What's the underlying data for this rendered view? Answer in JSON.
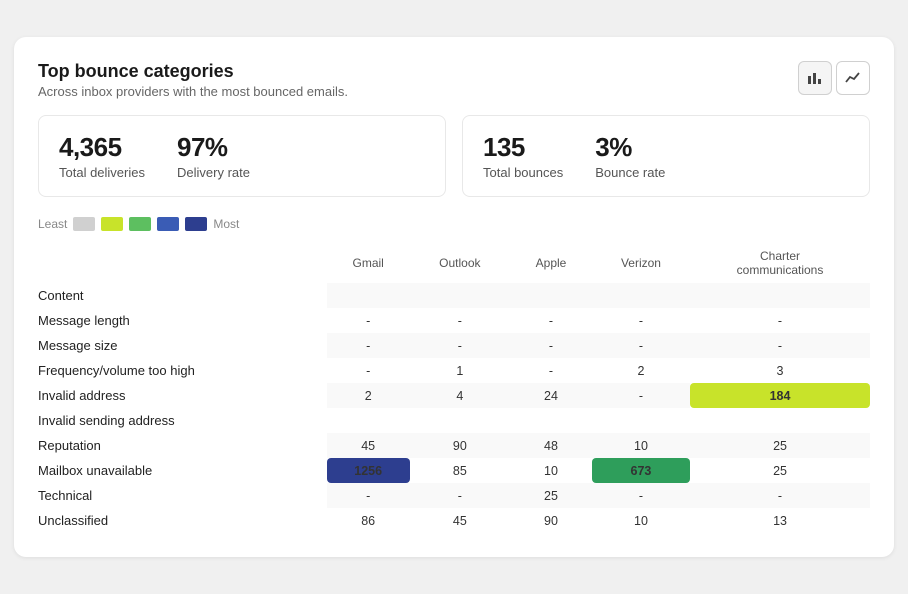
{
  "card": {
    "title": "Top bounce categories",
    "subtitle": "Across inbox providers with the most bounced emails."
  },
  "icons": {
    "bar_chart": "⬛",
    "line_chart": "📈"
  },
  "stats": {
    "left": [
      {
        "value": "4,365",
        "label": "Total deliveries"
      },
      {
        "value": "97%",
        "label": "Delivery rate"
      }
    ],
    "right": [
      {
        "value": "135",
        "label": "Total bounces"
      },
      {
        "value": "3%",
        "label": "Bounce rate"
      }
    ]
  },
  "legend": {
    "least": "Least",
    "most": "Most",
    "swatches": [
      "#d0d0d0",
      "#c8e32a",
      "#5dbf60",
      "#3a5cb5",
      "#2d3e8f"
    ]
  },
  "table": {
    "columns": [
      "",
      "Gmail",
      "Outlook",
      "Apple",
      "Verizon",
      "Charter\ncommunications"
    ],
    "rows": [
      {
        "category": "Content",
        "gmail": "",
        "outlook": "",
        "apple": "",
        "verizon": "",
        "charter": ""
      },
      {
        "category": "Message length",
        "gmail": "-",
        "outlook": "-",
        "apple": "-",
        "verizon": "-",
        "charter": "-"
      },
      {
        "category": "Message size",
        "gmail": "-",
        "outlook": "-",
        "apple": "-",
        "verizon": "-",
        "charter": "-"
      },
      {
        "category": "Frequency/volume too high",
        "gmail": "-",
        "outlook": "1",
        "apple": "-",
        "verizon": "2",
        "charter": "3"
      },
      {
        "category": "Invalid address",
        "gmail": "2",
        "outlook": "4",
        "apple": "24",
        "verizon": "-",
        "charter": "184",
        "charter_highlight": "yellow"
      },
      {
        "category": "Invalid sending address",
        "gmail": "",
        "outlook": "",
        "apple": "",
        "verizon": "",
        "charter": ""
      },
      {
        "category": "Reputation",
        "gmail": "45",
        "outlook": "90",
        "apple": "48",
        "verizon": "10",
        "charter": "25"
      },
      {
        "category": "Mailbox unavailable",
        "gmail": "1256",
        "outlook": "85",
        "apple": "10",
        "verizon": "673",
        "charter": "25",
        "gmail_highlight": "blue",
        "verizon_highlight": "green"
      },
      {
        "category": "Technical",
        "gmail": "-",
        "outlook": "-",
        "apple": "25",
        "verizon": "-",
        "charter": "-"
      },
      {
        "category": "Unclassified",
        "gmail": "86",
        "outlook": "45",
        "apple": "90",
        "verizon": "10",
        "charter": "13"
      }
    ]
  }
}
